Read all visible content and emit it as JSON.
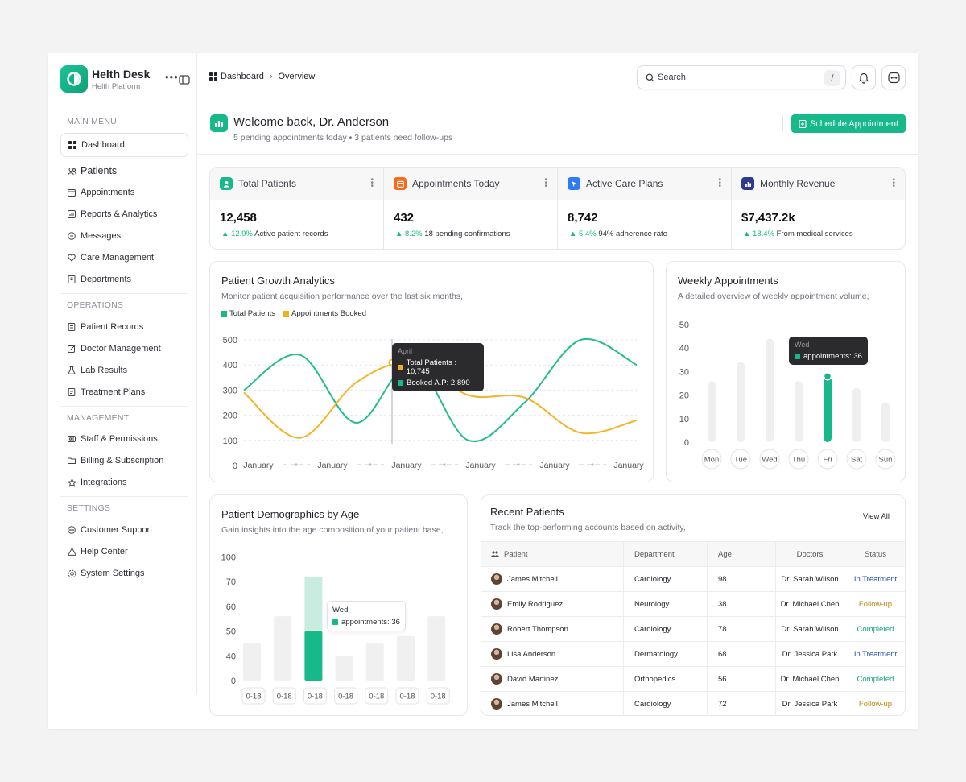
{
  "brand": {
    "title": "Helth Desk",
    "subtitle": "Helth Platform"
  },
  "sidebar": {
    "main_label": "MAIN MENU",
    "main_items": [
      "Dashboard",
      "Patients",
      "Appointments",
      "Reports & Analytics",
      "Messages",
      "Care Management",
      "Departments"
    ],
    "ops_label": "OPERATIONS",
    "ops_items": [
      "Patient Records",
      "Doctor Management",
      "Lab Results",
      "Treatment Plans"
    ],
    "mgmt_label": "MANAGEMENT",
    "mgmt_items": [
      "Staff & Permissions",
      "Billing & Subscription",
      "Integrations"
    ],
    "settings_label": "SETTINGS",
    "settings_items": [
      "Customer Support",
      "Help Center",
      "System Settings"
    ]
  },
  "topbar": {
    "crumb_root": "Dashboard",
    "crumb_current": "Overview",
    "search_placeholder": "Search",
    "search_shortcut": "/"
  },
  "welcome": {
    "title": "Welcome back, Dr. Anderson",
    "subtitle": "5 pending appointments today • 3 patients need follow-ups",
    "cta": "Schedule Appointment"
  },
  "stats": [
    {
      "label": "Total Patients",
      "value": "12,458",
      "pct": "12.9%",
      "note": "Active patient records",
      "color": "#17b88a"
    },
    {
      "label": "Appointments Today",
      "value": "432",
      "pct": "8.2%",
      "note": "18 pending confirmations",
      "color": "#f56a1f"
    },
    {
      "label": "Active Care Plans",
      "value": "8,742",
      "pct": "5.4%",
      "note": "94% adherence rate",
      "color": "#2f7bf5"
    },
    {
      "label": "Monthly Revenue",
      "value": "$7,437.2k",
      "pct": "18.4%",
      "note": "From medical services",
      "color": "#2b3a8c"
    }
  ],
  "growth": {
    "title": "Patient Growth Analytics",
    "subtitle": "Monitor patient acquisition performance over the last six months,",
    "tooltip": {
      "month": "April",
      "line1": "Total Patients : 10,745",
      "line2": "Booked A.P: 2,890"
    }
  },
  "weekly": {
    "title": "Weekly Appointments",
    "subtitle": "A detailed overview of weekly appointment volume,",
    "tooltip": {
      "day": "Wed",
      "line": "appointments: 36"
    }
  },
  "demo": {
    "title": "Patient Demographics by Age",
    "subtitle": "Gain insights into the age composition of your patient base,",
    "tooltip": {
      "day": "Wed",
      "line": "appointments: 36"
    }
  },
  "recent": {
    "title": "Recent Patients",
    "subtitle": "Track the top-performing accounts based on activity,",
    "view_all": "View All",
    "columns": [
      "Patient",
      "Department",
      "Age",
      "Doctors",
      "Status"
    ],
    "rows": [
      {
        "name": "James Mitchell",
        "dept": "Cardiology",
        "age": "98",
        "doctor": "Dr. Sarah Wilson",
        "status": "In Treatment",
        "status_color": "#1f4fb8"
      },
      {
        "name": "Emily Rodriguez",
        "dept": "Neurology",
        "age": "38",
        "doctor": "Dr. Michael Chen",
        "status": "Follow-up",
        "status_color": "#b8890f"
      },
      {
        "name": "Robert Thompson",
        "dept": "Cardiology",
        "age": "78",
        "doctor": "Dr. Sarah Wilson",
        "status": "Completed",
        "status_color": "#17a37c"
      },
      {
        "name": "Lisa Anderson",
        "dept": "Dermatology",
        "age": "68",
        "doctor": "Dr. Jessica Park",
        "status": "In Treatment",
        "status_color": "#1f4fb8"
      },
      {
        "name": "David Martinez",
        "dept": "Orthopedics",
        "age": "56",
        "doctor": "Dr. Michael Chen",
        "status": "Completed",
        "status_color": "#17a37c"
      },
      {
        "name": "James Mitchell",
        "dept": "Cardiology",
        "age": "72",
        "doctor": "Dr. Jessica Park",
        "status": "Follow-up",
        "status_color": "#b8890f"
      }
    ]
  },
  "chart_data": [
    {
      "type": "line",
      "title": "Patient Growth Analytics",
      "categories": [
        "January",
        "January",
        "January",
        "January",
        "January",
        "January"
      ],
      "ylim": [
        0,
        500
      ],
      "yticks": [
        0,
        100,
        200,
        300,
        400,
        500
      ],
      "series": [
        {
          "name": "Total Patients",
          "color": "#17b88a",
          "values": [
            300,
            440,
            170,
            410,
            100,
            250,
            500,
            400
          ]
        },
        {
          "name": "Appointments Booked",
          "color": "#f2b01e",
          "values": [
            290,
            110,
            330,
            410,
            280,
            270,
            130,
            180
          ]
        }
      ]
    },
    {
      "type": "bar",
      "title": "Weekly Appointments",
      "categories": [
        "Mon",
        "Tue",
        "Wed",
        "Thu",
        "Fri",
        "Sat",
        "Sun"
      ],
      "values": [
        26,
        34,
        44,
        26,
        28,
        23,
        17
      ],
      "highlight": "Fri",
      "ylim": [
        0,
        50
      ],
      "yticks": [
        0,
        10,
        20,
        30,
        40,
        50
      ]
    },
    {
      "type": "bar",
      "title": "Patient Demographics by Age",
      "categories": [
        "0-18",
        "0-18",
        "0-18",
        "0-18",
        "0-18",
        "0-18",
        "0-18"
      ],
      "values": [
        45,
        56,
        50,
        40,
        45,
        48,
        56
      ],
      "stack_top": [
        0,
        0,
        26,
        0,
        0,
        0,
        0
      ],
      "highlight_index": 2,
      "yticks": [
        0,
        40,
        50,
        60,
        70,
        100
      ]
    }
  ]
}
